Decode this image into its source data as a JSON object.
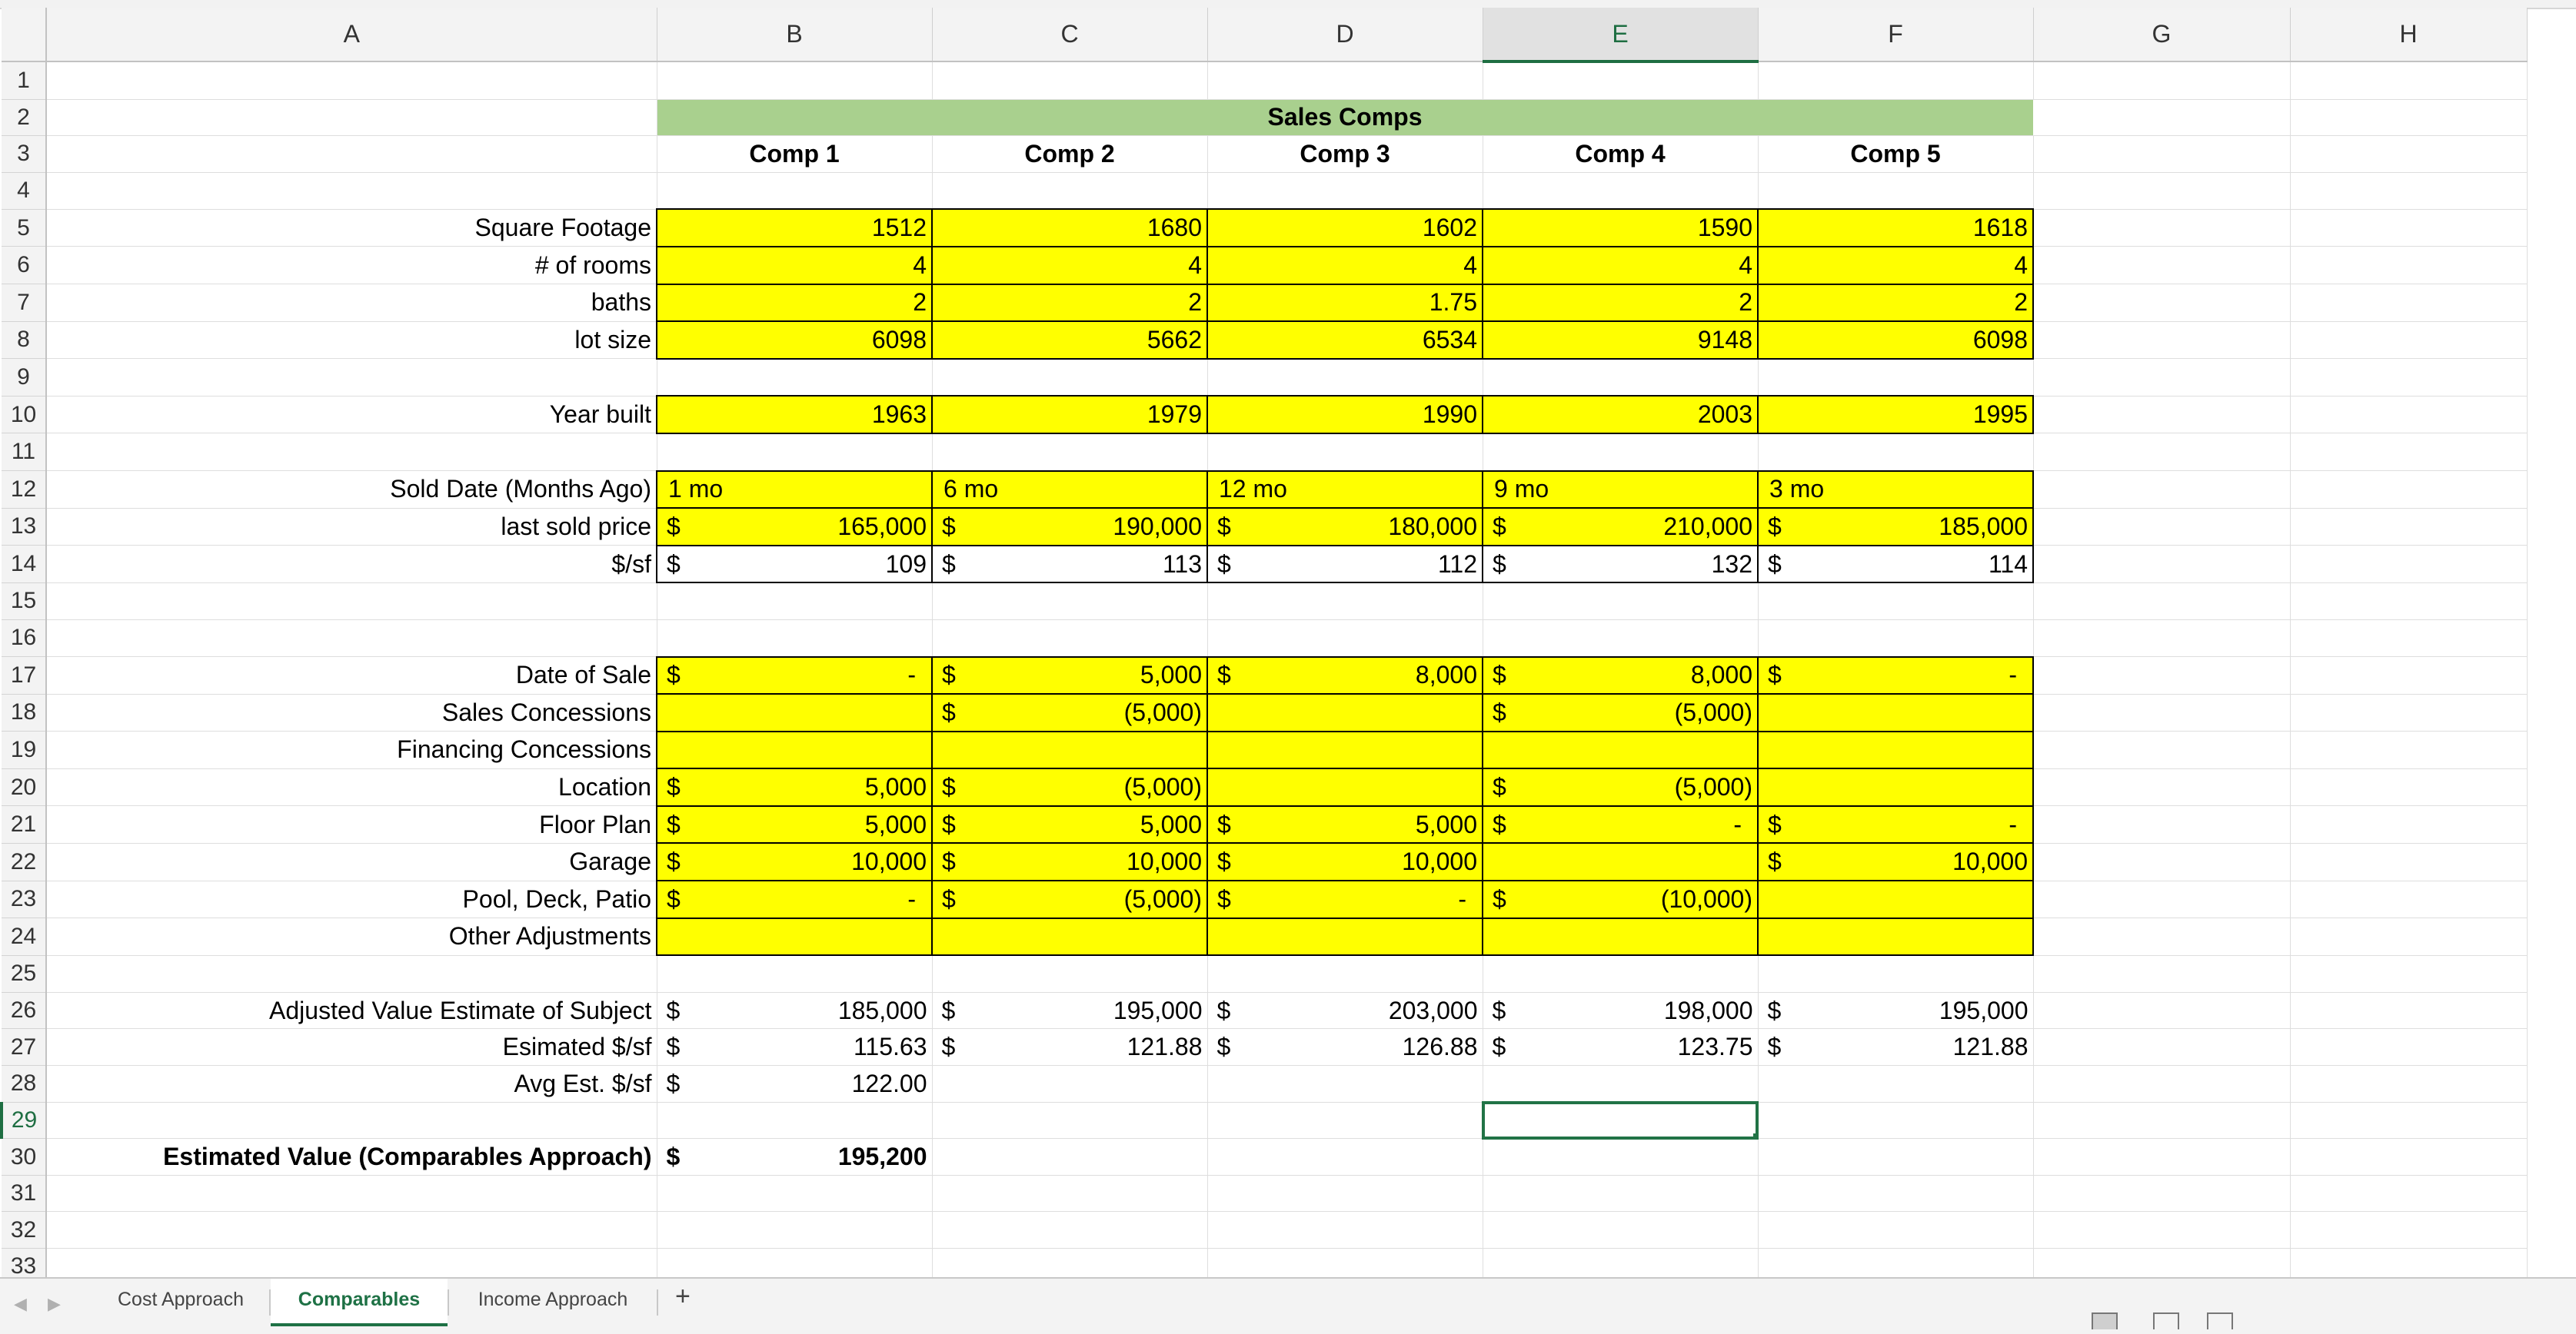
{
  "sheet": {
    "columns": [
      "A",
      "B",
      "C",
      "D",
      "E",
      "F",
      "G",
      "H"
    ],
    "selected_column": "E",
    "selected_row": "29",
    "selected_cell": "E29",
    "section_title": "Sales Comps",
    "comp_headers": [
      "Comp 1",
      "Comp 2",
      "Comp 3",
      "Comp 4",
      "Comp 5"
    ],
    "rows": {
      "square_footage": {
        "label": "Square Footage",
        "values": [
          "1512",
          "1680",
          "1602",
          "1590",
          "1618"
        ]
      },
      "rooms": {
        "label": "# of rooms",
        "values": [
          "4",
          "4",
          "4",
          "4",
          "4"
        ]
      },
      "baths": {
        "label": "baths",
        "values": [
          "2",
          "2",
          "1.75",
          "2",
          "2"
        ]
      },
      "lot_size": {
        "label": "lot size",
        "values": [
          "6098",
          "5662",
          "6534",
          "9148",
          "6098"
        ]
      },
      "year_built": {
        "label": "Year built",
        "values": [
          "1963",
          "1979",
          "1990",
          "2003",
          "1995"
        ]
      },
      "sold_date": {
        "label": "Sold Date (Months Ago)",
        "values": [
          "1 mo",
          "6 mo",
          "12 mo",
          "9 mo",
          "3 mo"
        ]
      },
      "last_sold_price": {
        "label": "last sold price",
        "values": [
          "165,000",
          "190,000",
          "180,000",
          "210,000",
          "185,000"
        ]
      },
      "price_per_sf": {
        "label": "$/sf",
        "values": [
          "109",
          "113",
          "112",
          "132",
          "114"
        ]
      },
      "date_of_sale": {
        "label": "Date of Sale",
        "values": [
          "-",
          "5,000",
          "8,000",
          "8,000",
          "-"
        ]
      },
      "sales_concessions": {
        "label": "Sales Concessions",
        "values": [
          "",
          "(5,000)",
          "",
          "(5,000)",
          ""
        ]
      },
      "financing_concessions": {
        "label": "Financing Concessions",
        "values": [
          "",
          "",
          "",
          "",
          ""
        ]
      },
      "location": {
        "label": "Location",
        "values": [
          "5,000",
          "(5,000)",
          "",
          "(5,000)",
          ""
        ]
      },
      "floor_plan": {
        "label": "Floor Plan",
        "values": [
          "5,000",
          "5,000",
          "5,000",
          "-",
          "-"
        ]
      },
      "garage": {
        "label": "Garage",
        "values": [
          "10,000",
          "10,000",
          "10,000",
          "",
          "10,000"
        ]
      },
      "pool_deck_patio": {
        "label": "Pool, Deck, Patio",
        "values": [
          "-",
          "(5,000)",
          "-",
          "(10,000)",
          ""
        ]
      },
      "other_adjustments": {
        "label": "Other Adjustments",
        "values": [
          "",
          "",
          "",
          "",
          ""
        ]
      },
      "adjusted_value": {
        "label": "Adjusted Value Estimate of Subject",
        "values": [
          "185,000",
          "195,000",
          "203,000",
          "198,000",
          "195,000"
        ]
      },
      "estimated_psf": {
        "label": "Esimated $/sf",
        "values": [
          "115.63",
          "121.88",
          "126.88",
          "123.75",
          "121.88"
        ]
      },
      "avg_est_psf": {
        "label": "Avg Est. $/sf",
        "value": "122.00"
      },
      "estimated_value": {
        "label": "Estimated Value (Comparables Approach)",
        "value": "195,200"
      }
    },
    "currency_symbol": "$"
  },
  "tabs": {
    "items": [
      "Cost Approach",
      "Comparables",
      "Income Approach"
    ],
    "active": "Comparables",
    "add_label": "+",
    "prev_icon": "◀",
    "next_icon": "▶"
  },
  "colors": {
    "input_fill": "#ffff00",
    "header_band": "#a9d08e",
    "selection": "#217346"
  }
}
